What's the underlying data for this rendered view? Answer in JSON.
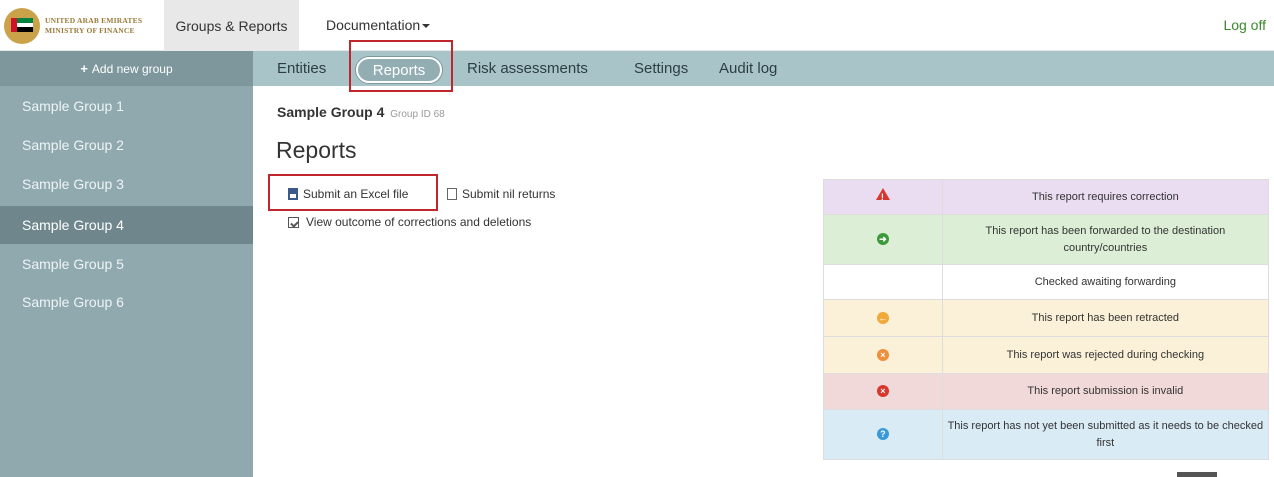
{
  "header": {
    "logo_line1": "UNITED ARAB EMIRATES",
    "logo_line2": "MINISTRY OF FINANCE",
    "nav_groups": "Groups & Reports",
    "nav_docs": "Documentation",
    "logoff": "Log off"
  },
  "sidebar": {
    "add_group": "Add new group",
    "items": [
      {
        "label": "Sample Group 1"
      },
      {
        "label": "Sample Group 2"
      },
      {
        "label": "Sample Group 3"
      },
      {
        "label": "Sample Group 4",
        "active": true
      },
      {
        "label": "Sample Group 5"
      },
      {
        "label": "Sample Group 6"
      }
    ]
  },
  "tabs": {
    "entities": "Entities",
    "reports": "Reports",
    "risk": "Risk assessments",
    "settings": "Settings",
    "audit": "Audit log"
  },
  "content": {
    "group_name": "Sample Group 4",
    "group_id": "Group ID 68",
    "title": "Reports",
    "submit_excel": "Submit an Excel file",
    "submit_nil": "Submit nil returns",
    "view_outcome": "View outcome of corrections and deletions"
  },
  "legend": [
    {
      "icon": "warning-icon",
      "text": "This report requires correction",
      "bg": "#eadcf1"
    },
    {
      "icon": "arrow-right-circle-icon",
      "text": "This report has been forwarded to the destination country/countries",
      "bg": "#dcefd6",
      "color": "#3c9a3c"
    },
    {
      "icon": "",
      "text": "Checked awaiting forwarding",
      "bg": "#ffffff"
    },
    {
      "icon": "arrow-left-circle-icon",
      "text": "This report has been retracted",
      "bg": "#fbf1d9",
      "color": "#f0a93b"
    },
    {
      "icon": "x-circle-icon",
      "text": "This report was rejected during checking",
      "bg": "#fbf1d9",
      "color": "#ef8e3b"
    },
    {
      "icon": "x-circle-icon",
      "text": "This report submission is invalid",
      "bg": "#f2d9d9",
      "color": "#d9362e"
    },
    {
      "icon": "question-circle-icon",
      "text": "This report has not yet been submitted as it needs to be checked first",
      "bg": "#d9ebf5",
      "color": "#3a9ad9"
    }
  ]
}
